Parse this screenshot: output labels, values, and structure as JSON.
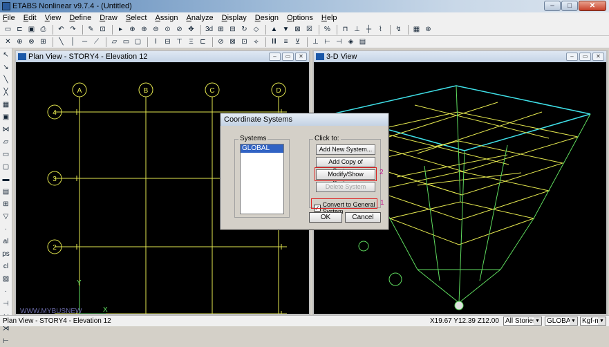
{
  "window": {
    "title": "ETABS Nonlinear v9.7.4 - (Untitled)"
  },
  "menu": [
    "File",
    "Edit",
    "View",
    "Define",
    "Draw",
    "Select",
    "Assign",
    "Analyze",
    "Display",
    "Design",
    "Options",
    "Help"
  ],
  "plan_view": {
    "title": "Plan View - STORY4 - Elevation 12",
    "col_labels": [
      "A",
      "B",
      "C",
      "D"
    ],
    "row_labels": [
      "4",
      "3",
      "2"
    ],
    "watermark": "WWW.MYBUSNEW",
    "axis_y": "Y",
    "axis_x": "X"
  },
  "view3d": {
    "title": "3-D View"
  },
  "dialog": {
    "title": "Coordinate Systems",
    "systems_label": "Systems",
    "systems": [
      "GLOBAL"
    ],
    "clickto_label": "Click to:",
    "add_new": "Add New System...",
    "add_copy": "Add Copy of System...",
    "modify": "Modify/Show System...",
    "delete": "Delete System",
    "convert": "Convert to General System",
    "ok": "OK",
    "cancel": "Cancel",
    "annot_modify": "2",
    "annot_convert": "1"
  },
  "status": {
    "left": "Plan View - STORY4 - Elevation 12",
    "coords": "X19.67  Y12.39  Z12.00",
    "stories": "All Stories",
    "system": "GLOBAL",
    "units": "Kgf-m"
  },
  "colors": {
    "grid": "#e5e84f",
    "frame": "#5fdc5f",
    "roof": "#3fe0e8",
    "highlight": "#dd2222"
  }
}
